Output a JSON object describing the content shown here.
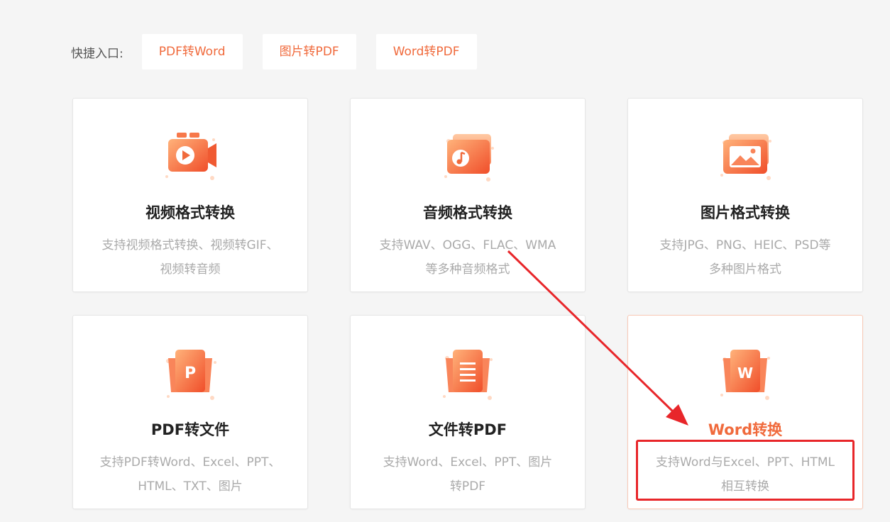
{
  "quick_entry": {
    "label": "快捷入口:",
    "buttons": [
      "PDF转Word",
      "图片转PDF",
      "Word转PDF"
    ]
  },
  "cards": [
    {
      "title": "视频格式转换",
      "desc_line1": "支持视频格式转换、视频转GIF、",
      "desc_line2": "视频转音频",
      "icon": "video-icon"
    },
    {
      "title": "音频格式转换",
      "desc_line1": "支持WAV、OGG、FLAC、WMA",
      "desc_line2": "等多种音频格式",
      "icon": "music-icon"
    },
    {
      "title": "图片格式转换",
      "desc_line1": "支持JPG、PNG、HEIC、PSD等",
      "desc_line2": "多种图片格式",
      "icon": "image-icon"
    },
    {
      "title": "PDF转文件",
      "desc_line1": "支持PDF转Word、Excel、PPT、",
      "desc_line2": "HTML、TXT、图片",
      "icon": "pdf-p-icon"
    },
    {
      "title": "文件转PDF",
      "desc_line1": "支持Word、Excel、PPT、图片",
      "desc_line2": "转PDF",
      "icon": "document-icon"
    },
    {
      "title": "Word转换",
      "desc_line1": "支持Word与Excel、PPT、HTML",
      "desc_line2": "相互转换",
      "icon": "word-w-icon"
    }
  ],
  "colors": {
    "accent": "#f06a3c",
    "icon_gradient_light": "#ffb27a",
    "icon_gradient_dark": "#f04e2a",
    "annotation_red": "#e8262a"
  },
  "icon_letters": {
    "pdf": "P",
    "word": "W"
  }
}
